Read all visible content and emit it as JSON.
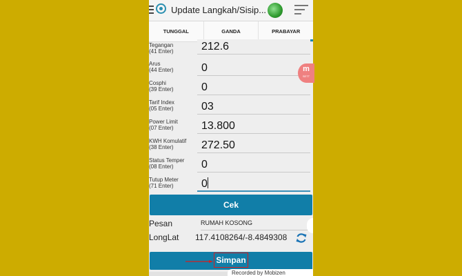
{
  "app": {
    "title": "Update Langkah/Sisip..."
  },
  "tabs": [
    {
      "label": "TUNGGAL",
      "active": false
    },
    {
      "label": "GANDA",
      "active": false
    },
    {
      "label": "PRABAYAR",
      "active": true
    }
  ],
  "fields": [
    {
      "label": "Tegangan\n(41 Enter)",
      "value": "212.6"
    },
    {
      "label": "Arus\n(44 Enter)",
      "value": "0"
    },
    {
      "label": "Cosphi\n(39 Enter)",
      "value": "0"
    },
    {
      "label": "Tarif Index\n(05 Enter)",
      "value": "03"
    },
    {
      "label": "Power Limit\n(07 Enter)",
      "value": "13.800"
    },
    {
      "label": "KWH Komulatif\n(38 Enter)",
      "value": "272.50"
    },
    {
      "label": "Status Temper\n(08 Enter)",
      "value": "0"
    },
    {
      "label": "Tutup Meter\n(71 Enter)",
      "value": "0"
    }
  ],
  "cek_button": "Cek",
  "pesan": {
    "label": "Pesan",
    "value": "RUMAH KOSONG"
  },
  "longlat": {
    "label": "LongLat",
    "value": "117.4108264/-8.4849308"
  },
  "simpan_button": "Simpan",
  "watermark": "Recorded by Mobizen",
  "floating_badge": {
    "letter": "m",
    "sub": "SETT"
  },
  "colors": {
    "accent": "#117ea8",
    "background": "#cdac00",
    "highlight_box": "#d32020"
  },
  "icons": [
    "menu-icon",
    "app-logo-icon",
    "avatar",
    "filter-icon",
    "refresh-icon",
    "arrow-icon"
  ]
}
